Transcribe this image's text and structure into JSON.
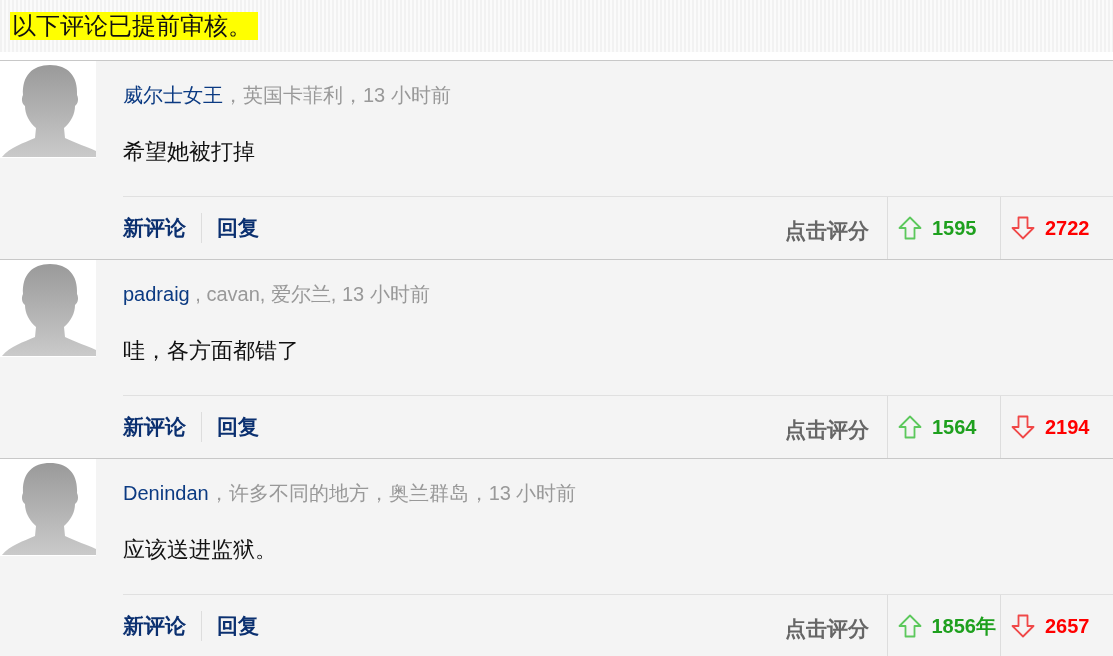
{
  "notice": "以下评论已提前审核。",
  "comments": [
    {
      "author": "威尔士女王",
      "meta": "，英国卡菲利，13 小时前",
      "text": "希望她被打掉",
      "actions": [
        "新评论",
        "回复"
      ],
      "rate_label": "点击评分",
      "votes_up": "1595",
      "votes_down": "2722"
    },
    {
      "author": "padraig",
      "meta": " , cavan, 爱尔兰, 13 小时前",
      "text": "哇，各方面都错了",
      "actions": [
        "新评论",
        "回复"
      ],
      "rate_label": "点击评分",
      "votes_up": "1564",
      "votes_down": "2194"
    },
    {
      "author": "Denindan",
      "meta": "，许多不同的地方，奥兰群岛，13 小时前",
      "text": "应该送进监狱。",
      "actions": [
        "新评论",
        "回复"
      ],
      "rate_label": "点击评分",
      "votes_up": "1856年",
      "votes_down": "2657"
    }
  ]
}
